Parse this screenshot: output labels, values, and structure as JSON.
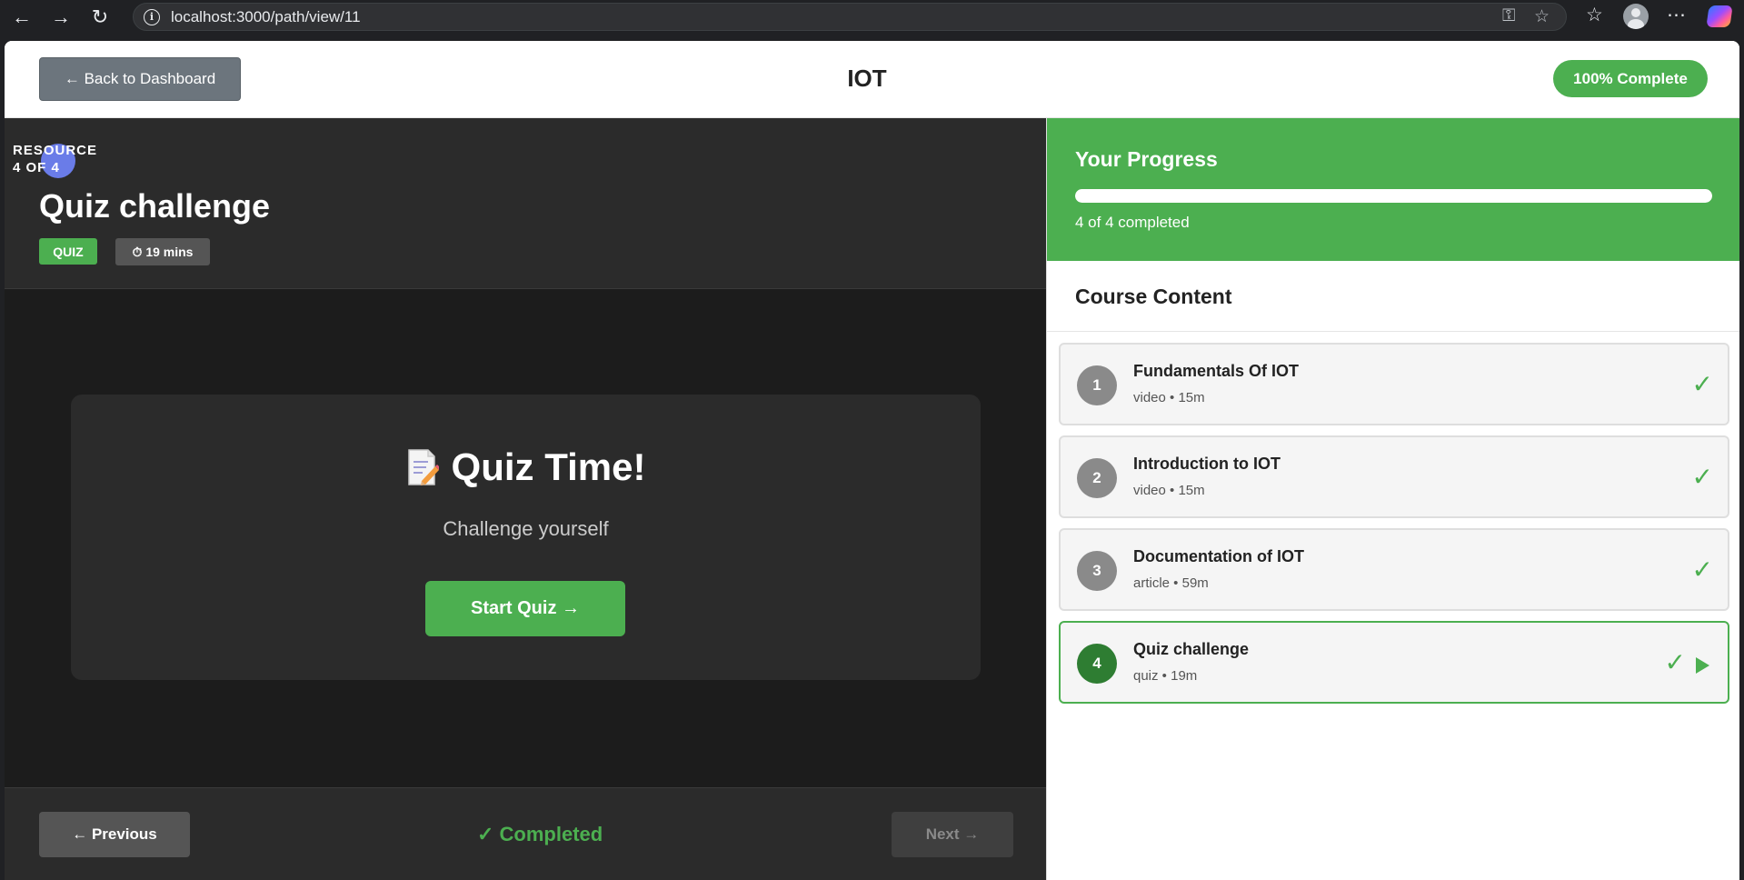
{
  "browser": {
    "url": "localhost:3000/path/view/11"
  },
  "topbar": {
    "back_label": "← Back to Dashboard",
    "course_title": "IOT",
    "completion_badge": "100% Complete"
  },
  "resource": {
    "counter_line1": "RESOURCE",
    "counter_line2": "4 OF 4",
    "title": "Quiz challenge",
    "type_badge": "QUIZ",
    "duration_badge": "⏱ 19 mins"
  },
  "quiz_card": {
    "heading": "Quiz Time!",
    "icon": "memo-icon",
    "subtitle": "Challenge yourself",
    "start_label": "Start Quiz →"
  },
  "footer": {
    "previous_label": "← Previous",
    "status_label": "✓ Completed",
    "next_label": "Next →"
  },
  "progress": {
    "title": "Your Progress",
    "fraction": 1.0,
    "text": "4 of 4 completed"
  },
  "course_content": {
    "title": "Course Content",
    "lessons": [
      {
        "number": "1",
        "name": "Fundamentals Of IOT",
        "meta": "video • 15m",
        "completed": true,
        "active": false
      },
      {
        "number": "2",
        "name": "Introduction to IOT",
        "meta": "video • 15m",
        "completed": true,
        "active": false
      },
      {
        "number": "3",
        "name": "Documentation of IOT",
        "meta": "article • 59m",
        "completed": true,
        "active": false
      },
      {
        "number": "4",
        "name": "Quiz challenge",
        "meta": "quiz • 19m",
        "completed": true,
        "active": true
      }
    ],
    "check_glyph": "✓"
  },
  "colors": {
    "accent": "#4caf50",
    "accent_dark": "#2e7d32",
    "main_bg": "#1c1c1c",
    "card_bg": "#2b2b2b"
  }
}
